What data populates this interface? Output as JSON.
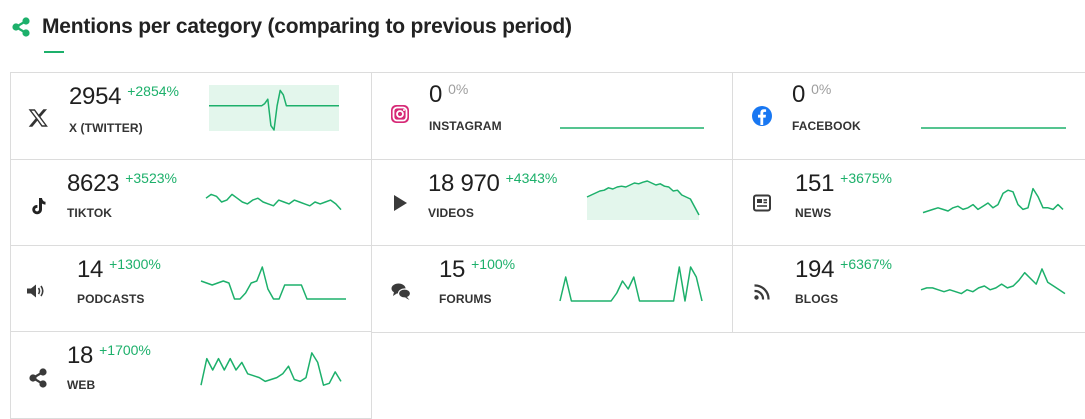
{
  "header": {
    "title": "Mentions per category (comparing to previous period)",
    "icon": "share-icon"
  },
  "colors": {
    "accent": "#1db06b",
    "area": "#e3f6ec",
    "zero_change": "#9e9e9e"
  },
  "cards": [
    {
      "key": "twitter",
      "icon": "x-twitter-icon",
      "value": "2954",
      "change": "+2854%",
      "label": "X (TWITTER)",
      "spark": [
        0.55,
        0.55,
        0.55,
        0.55,
        0.55,
        0.55,
        0.55,
        0.55,
        0.55,
        0.55,
        0.55,
        0.55,
        0.55,
        0.55,
        0.55,
        0.55,
        0.55,
        0.55,
        0.6,
        0.7,
        0.1,
        0.0,
        0.55,
        0.9,
        0.8,
        0.55,
        0.55,
        0.55,
        0.55,
        0.55,
        0.55,
        0.55,
        0.55,
        0.55,
        0.55,
        0.55,
        0.55,
        0.55,
        0.55,
        0.55,
        0.55,
        0.55,
        0.55
      ],
      "area": true
    },
    {
      "key": "instagram",
      "icon": "instagram-icon",
      "value": "0",
      "change": "0%",
      "label": "INSTAGRAM",
      "spark": [],
      "area": false,
      "flat": true
    },
    {
      "key": "facebook",
      "icon": "facebook-icon",
      "value": "0",
      "change": "0%",
      "label": "FACEBOOK",
      "spark": [],
      "area": false,
      "flat": true
    },
    {
      "key": "tiktok",
      "icon": "tiktok-icon",
      "value": "8623",
      "change": "+3523%",
      "label": "TIKTOK",
      "spark": [
        0.6,
        0.7,
        0.65,
        0.5,
        0.55,
        0.7,
        0.6,
        0.5,
        0.45,
        0.55,
        0.6,
        0.5,
        0.45,
        0.4,
        0.55,
        0.5,
        0.45,
        0.55,
        0.5,
        0.45,
        0.4,
        0.5,
        0.45,
        0.5,
        0.55,
        0.45,
        0.3
      ],
      "area": false
    },
    {
      "key": "videos",
      "icon": "play-icon",
      "value": "18 970",
      "change": "+4343%",
      "label": "VIDEOS",
      "spark": [
        0.55,
        0.6,
        0.65,
        0.7,
        0.72,
        0.78,
        0.75,
        0.8,
        0.82,
        0.8,
        0.85,
        0.9,
        0.88,
        0.92,
        0.95,
        0.9,
        0.85,
        0.88,
        0.82,
        0.8,
        0.7,
        0.72,
        0.6,
        0.55,
        0.5,
        0.3,
        0.1
      ],
      "area": true
    },
    {
      "key": "news",
      "icon": "newspaper-icon",
      "value": "151",
      "change": "+3675%",
      "label": "NEWS",
      "spark": [
        0.2,
        0.25,
        0.3,
        0.35,
        0.3,
        0.25,
        0.35,
        0.4,
        0.3,
        0.35,
        0.45,
        0.3,
        0.4,
        0.5,
        0.35,
        0.45,
        0.8,
        0.9,
        0.85,
        0.45,
        0.3,
        0.35,
        0.95,
        0.7,
        0.35,
        0.35,
        0.3,
        0.45,
        0.3
      ],
      "area": false
    },
    {
      "key": "podcasts",
      "icon": "speaker-icon",
      "value": "14",
      "change": "+1300%",
      "label": "PODCASTS",
      "spark": [
        0.6,
        0.55,
        0.5,
        0.55,
        0.6,
        0.55,
        0.15,
        0.15,
        0.3,
        0.55,
        0.6,
        0.95,
        0.4,
        0.15,
        0.15,
        0.5,
        0.5,
        0.5,
        0.5,
        0.15,
        0.15,
        0.15,
        0.15,
        0.15,
        0.15,
        0.15,
        0.15
      ],
      "area": false
    },
    {
      "key": "forums",
      "icon": "chat-icon",
      "value": "15",
      "change": "+100%",
      "label": "FORUMS",
      "spark": [
        0.1,
        0.7,
        0.1,
        0.1,
        0.1,
        0.1,
        0.1,
        0.1,
        0.1,
        0.1,
        0.3,
        0.6,
        0.4,
        0.7,
        0.1,
        0.1,
        0.1,
        0.1,
        0.1,
        0.1,
        0.1,
        0.95,
        0.1,
        0.95,
        0.7,
        0.1
      ],
      "area": false
    },
    {
      "key": "blogs",
      "icon": "rss-icon",
      "value": "194",
      "change": "+6367%",
      "label": "BLOGS",
      "spark": [
        0.4,
        0.45,
        0.45,
        0.4,
        0.35,
        0.4,
        0.35,
        0.3,
        0.4,
        0.35,
        0.45,
        0.5,
        0.4,
        0.45,
        0.55,
        0.45,
        0.5,
        0.65,
        0.85,
        0.7,
        0.55,
        0.95,
        0.6,
        0.5,
        0.4,
        0.3
      ],
      "area": false
    },
    {
      "key": "web",
      "icon": "share-icon",
      "value": "18",
      "change": "+1700%",
      "label": "WEB",
      "spark": [
        0.1,
        0.8,
        0.5,
        0.8,
        0.5,
        0.8,
        0.5,
        0.7,
        0.4,
        0.35,
        0.3,
        0.2,
        0.25,
        0.3,
        0.4,
        0.6,
        0.25,
        0.2,
        0.3,
        0.95,
        0.7,
        0.1,
        0.15,
        0.45,
        0.2
      ],
      "area": false
    }
  ]
}
